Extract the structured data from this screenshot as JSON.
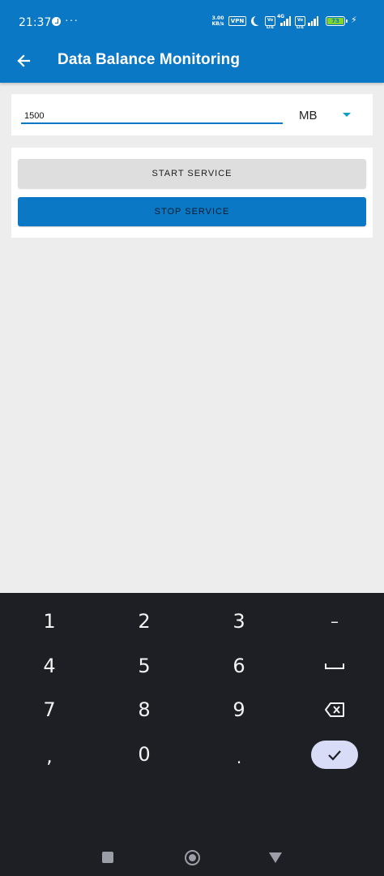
{
  "status_bar": {
    "time": "21:37",
    "dots": "···",
    "speed_value": "3.00",
    "speed_unit": "KB/s",
    "vpn": "VPN",
    "volte": "Vo LTE",
    "network": "4G",
    "battery": "73"
  },
  "app_bar": {
    "title": "Data Balance Monitoring"
  },
  "input": {
    "value": "1500",
    "unit": "MB"
  },
  "buttons": {
    "start": "START SERVICE",
    "stop": "STOP SERVICE"
  },
  "keyboard": {
    "k1": "1",
    "k2": "2",
    "k3": "3",
    "dash": "–",
    "k4": "4",
    "k5": "5",
    "k6": "6",
    "k7": "7",
    "k8": "8",
    "k9": "9",
    "comma": ",",
    "k0": "0",
    "period": "."
  },
  "colors": {
    "primary": "#0b78c6",
    "background": "#eeedee",
    "keyboard_bg": "#1d1f25",
    "done_key": "#d9dcf7",
    "battery": "#7fd32b"
  }
}
